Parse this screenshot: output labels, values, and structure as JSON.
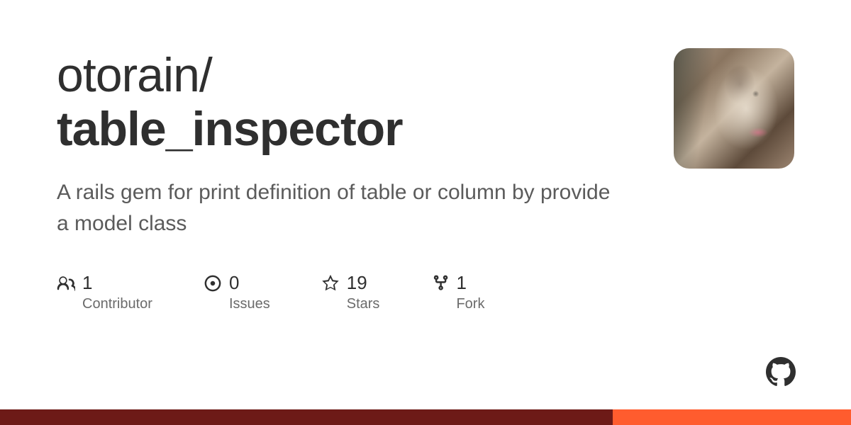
{
  "repo": {
    "owner": "otorain",
    "separator": "/",
    "name": "table_inspector",
    "description": "A rails gem for print definition of table or column by provide a model class"
  },
  "stats": [
    {
      "count": "1",
      "label": "Contributor"
    },
    {
      "count": "0",
      "label": "Issues"
    },
    {
      "count": "19",
      "label": "Stars"
    },
    {
      "count": "1",
      "label": "Fork"
    }
  ]
}
